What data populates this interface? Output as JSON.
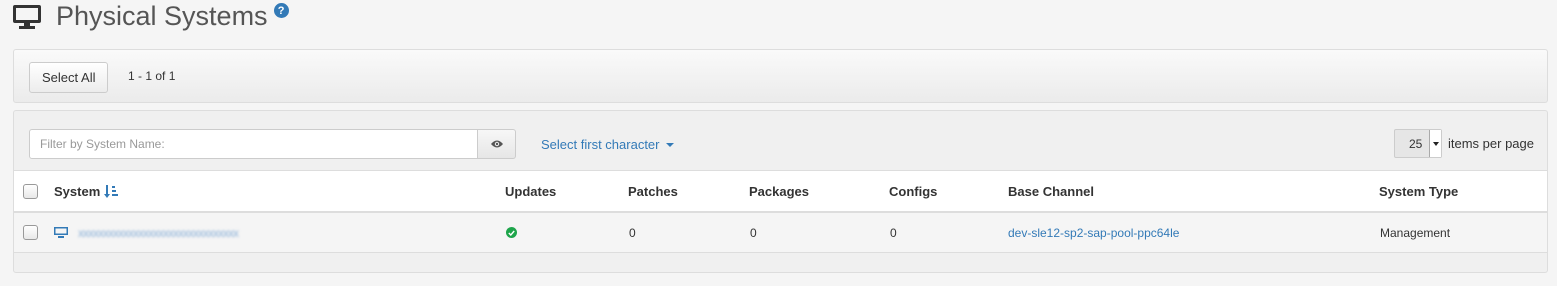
{
  "page": {
    "title": "Physical Systems",
    "help_glyph": "?",
    "icon": "monitor-icon"
  },
  "select_bar": {
    "select_all_label": "Select All",
    "count_text": "1 - 1 of 1"
  },
  "filter": {
    "placeholder": "Filter by System Name:",
    "value": "",
    "eye_icon": "eye-icon",
    "char_select_label": "Select first character"
  },
  "per_page": {
    "value": "25",
    "label": "items per page"
  },
  "table": {
    "columns": [
      "System",
      "Updates",
      "Patches",
      "Packages",
      "Configs",
      "Base Channel",
      "System Type"
    ],
    "rows": [
      {
        "system": "xxxxxxxxxxxxxxxxxxxxxxxxxxxxxxxx",
        "updates_icon": "ok-check-icon",
        "patches": "0",
        "packages": "0",
        "configs": "0",
        "base_channel": "dev-sle12-sp2-sap-pool-ppc64le",
        "system_type": "Management"
      }
    ]
  },
  "colors": {
    "link": "#337ab7",
    "ok": "#1ea54b"
  }
}
